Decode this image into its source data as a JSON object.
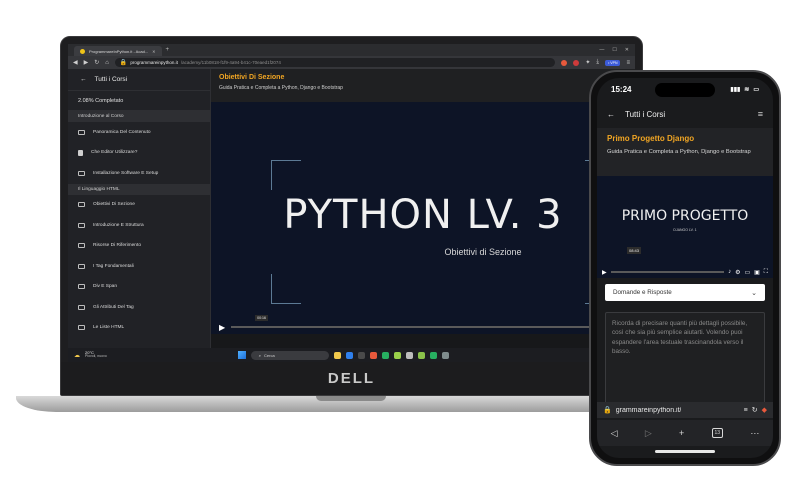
{
  "laptop": {
    "brand": "DELL",
    "browser": {
      "tab_title": "ProgrammareInPython.it - Acad...",
      "url_host": "programmareinpython.it",
      "url_path": "/academy/11b0818-f1f9-4a94-b41c-70eaed1f2074",
      "vpn_label": "• VPN"
    },
    "sidebar": {
      "back_label": "Tutti i Corsi",
      "progress": "2.08% Completato",
      "sections": [
        {
          "title": "Introduzione al Corso",
          "items": [
            {
              "label": "Panoramica Del Contenuto",
              "icon": "video-icon"
            },
            {
              "label": "Che Editor Utilizzare?",
              "icon": "document-icon"
            },
            {
              "label": "Installazione Software E Setup",
              "icon": "video-icon"
            }
          ]
        },
        {
          "title": "Il Linguaggio HTML",
          "items": [
            {
              "label": "Obiettivi Di Sezione",
              "icon": "video-icon"
            },
            {
              "label": "Introduzione E Struttura",
              "icon": "video-icon"
            },
            {
              "label": "Risorse Di Riferimento",
              "icon": "video-icon"
            },
            {
              "label": "I Tag Fondamentali",
              "icon": "video-icon"
            },
            {
              "label": "Div E Span",
              "icon": "video-icon"
            },
            {
              "label": "Gli Attributi Del Tag",
              "icon": "video-icon"
            },
            {
              "label": "Le Liste HTML",
              "icon": "video-icon"
            }
          ]
        }
      ]
    },
    "lesson": {
      "title": "Obiettivi Di Sezione",
      "subtitle": "Guida Pratica e Completa a Python, Django e Bootstrap",
      "video_title": "PYTHON LV. 3",
      "video_subtitle": "Obiettivi di Sezione",
      "video_time": "00:16"
    },
    "taskbar": {
      "temp": "20°C",
      "weather": "Piovoli, nuovo",
      "search": "Cerca",
      "lang": "ITA",
      "region": "INTL"
    }
  },
  "phone": {
    "time": "15:24",
    "back_label": "Tutti i Corsi",
    "lesson_title": "Primo Progetto Django",
    "lesson_subtitle": "Guida Pratica e Completa a Python, Django e Bootstrap",
    "video_title": "PRIMO PROGETTO",
    "video_subtitle": "DJANGO LV. 1",
    "video_time": "08:43",
    "select_value": "Domande e Risposte",
    "textarea_placeholder": "Ricorda di precisare quanti più dettagli possibile, così che sia più semplice aiutarti. Volendo puoi espandere l'area testuale trascinandola verso il basso.",
    "url": "grammareinpython.it/",
    "tab_count": "13"
  },
  "colors": {
    "accent": "#f2a623",
    "video_bg": "#0d1426"
  }
}
